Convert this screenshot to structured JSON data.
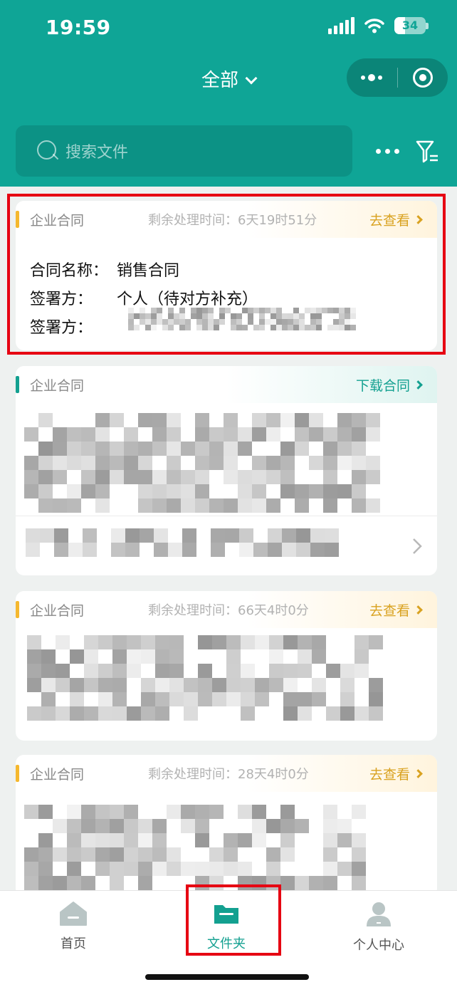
{
  "status_bar": {
    "time": "19:59",
    "battery": "34",
    "battery_level": 0.34
  },
  "header": {
    "title": "全部"
  },
  "search": {
    "placeholder": "搜索文件"
  },
  "cards": [
    {
      "type": "企业合同",
      "remaining_label": "剩余处理时间：",
      "remaining_value": "6天19时51分",
      "action": "去查看",
      "rows": [
        {
          "label": "合同名称：",
          "value": "销售合同"
        },
        {
          "label": "签署方：",
          "value": "个人（待对方补充）"
        },
        {
          "label": "签署方：",
          "value": ""
        }
      ]
    },
    {
      "type": "企业合同",
      "action": "下载合同"
    },
    {
      "type": "企业合同",
      "remaining_label": "剩余处理时间：",
      "remaining_value": "66天4时0分",
      "action": "去查看"
    },
    {
      "type": "企业合同",
      "remaining_label": "剩余处理时间：",
      "remaining_value": "28天4时0分",
      "action": "去查看"
    }
  ],
  "tabbar": [
    {
      "label": "首页",
      "icon": "home-icon"
    },
    {
      "label": "文件夹",
      "icon": "folder-icon",
      "active": true
    },
    {
      "label": "个人中心",
      "icon": "person-icon"
    }
  ],
  "colors": {
    "primary": "#0fa596",
    "accent_orange": "#d9a220",
    "highlight": "#e60012"
  }
}
